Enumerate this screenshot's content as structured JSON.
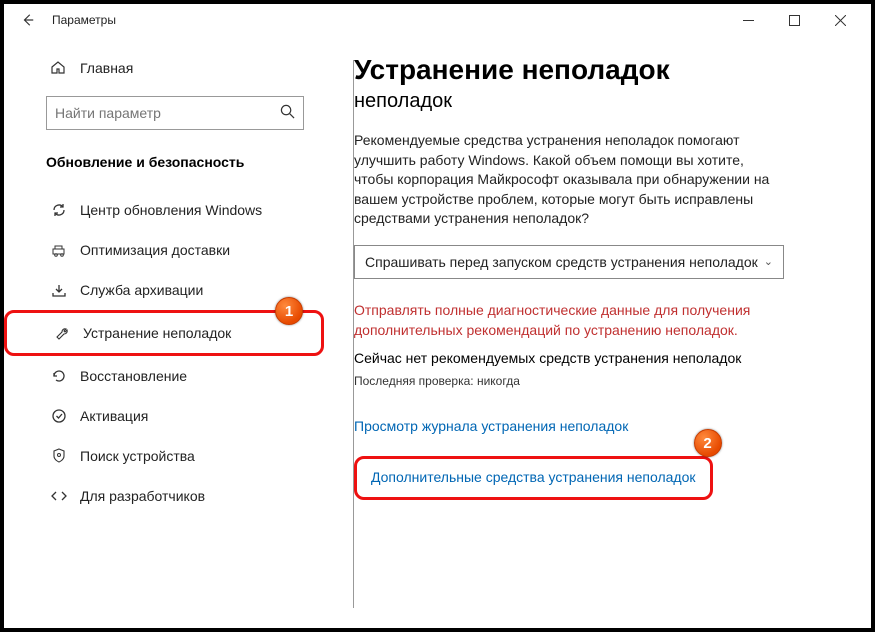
{
  "app_title": "Параметры",
  "home_label": "Главная",
  "search_placeholder": "Найти параметр",
  "section_title": "Обновление и безопасность",
  "nav": {
    "update": "Центр обновления Windows",
    "delivery": "Оптимизация доставки",
    "backup": "Служба архивации",
    "troubleshoot": "Устранение неполадок",
    "recovery": "Восстановление",
    "activation": "Активация",
    "findmydevice": "Поиск устройства",
    "developers": "Для разработчиков"
  },
  "main": {
    "h1": "Устранение неполадок",
    "h2": "неполадок",
    "desc": "Рекомендуемые средства устранения неполадок помогают улучшить работу Windows. Какой объем помощи вы хотите, чтобы корпорация Майкрософт оказывала при обнаружении на вашем устройстве проблем, которые могут быть исправлены средствами устранения неполадок?",
    "dropdown": "Спрашивать перед запуском средств устранения неполадок",
    "warn": "Отправлять полные диагностические данные для получения дополнительных рекомендаций по устранению неполадок.",
    "status": "Сейчас нет рекомендуемых средств устранения неполадок",
    "last_check_label": "Последняя проверка:",
    "last_check_value": "никогда",
    "history_link": "Просмотр журнала устранения неполадок",
    "additional_link": "Дополнительные средства устранения неполадок"
  },
  "badges": {
    "one": "1",
    "two": "2"
  }
}
